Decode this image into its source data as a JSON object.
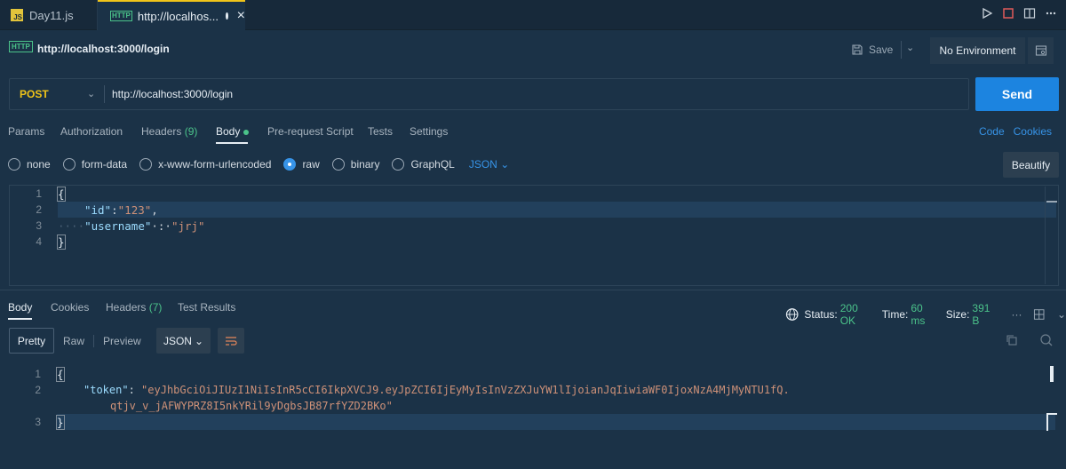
{
  "tabs": [
    {
      "badge": "JS",
      "label": "Day11.js"
    },
    {
      "badge": "HTTP",
      "label": "http://localhos..."
    }
  ],
  "request": {
    "badge": "HTTP",
    "title": "http://localhost:3000/login",
    "save_label": "Save",
    "environment": "No Environment",
    "method": "POST",
    "url": "http://localhost:3000/login",
    "send_label": "Send"
  },
  "request_tabs": {
    "params": "Params",
    "authorization": "Authorization",
    "headers": "Headers",
    "headers_count": "(9)",
    "body": "Body",
    "prerequest": "Pre-request Script",
    "tests": "Tests",
    "settings": "Settings",
    "code": "Code",
    "cookies": "Cookies"
  },
  "body_types": {
    "none": "none",
    "form_data": "form-data",
    "urlencoded": "x-www-form-urlencoded",
    "raw": "raw",
    "binary": "binary",
    "graphql": "GraphQL",
    "format": "JSON",
    "selected": "raw",
    "beautify": "Beautify"
  },
  "request_body": {
    "line_numbers": [
      "1",
      "2",
      "3",
      "4"
    ],
    "open_brace": "{",
    "line2_key": "\"id\"",
    "line2_colon": ":",
    "line2_value": "\"123\"",
    "line2_comma": ",",
    "line3_dots": "····",
    "line3_key": "\"username\"",
    "line3_colon": "·:·",
    "line3_value": "\"jrj\"",
    "close_brace": "}"
  },
  "response_tabs": {
    "body": "Body",
    "cookies": "Cookies",
    "headers": "Headers",
    "headers_count": "(7)",
    "test_results": "Test Results"
  },
  "status": {
    "status_label": "Status:",
    "status_value": "200 OK",
    "time_label": "Time:",
    "time_value": "60 ms",
    "size_label": "Size:",
    "size_value": "391 B"
  },
  "response_view": {
    "pretty": "Pretty",
    "raw": "Raw",
    "preview": "Preview",
    "format": "JSON"
  },
  "response_body": {
    "line_numbers": [
      "1",
      "2",
      "3"
    ],
    "open_brace": "{",
    "token_key": "\"token\"",
    "token_colon": ":",
    "token_part1": "\"eyJhbGciOiJIUzI1NiIsInR5cCI6IkpXVCJ9.eyJpZCI6IjEyMyIsInVzZXJuYW1lIjoianJqIiwiaWF0IjoxNzA4MjMyNTU1fQ.",
    "token_part2": "qtjv_v_jAFWYPRZ8I5nkYRil9yDgbsJB87rfYZD2BKo\"",
    "close_brace": "}"
  },
  "colors": {
    "accent": "#1c84e0",
    "success": "#4bc38a",
    "method": "#f0c419"
  }
}
